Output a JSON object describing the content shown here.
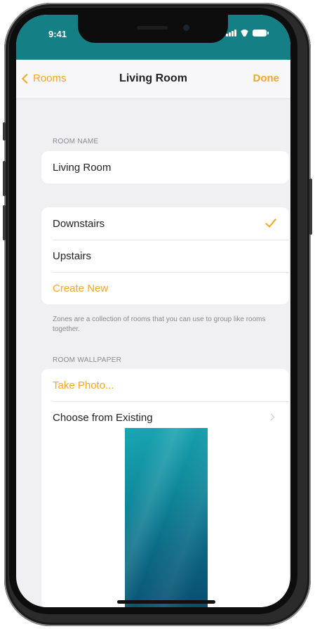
{
  "status_bar": {
    "time": "9:41",
    "signal_bars": 4,
    "battery_level": 1.0
  },
  "nav": {
    "back_label": "Rooms",
    "title": "Living Room",
    "done_label": "Done"
  },
  "room_name": {
    "header": "ROOM NAME",
    "value": "Living Room"
  },
  "zones": {
    "items": [
      {
        "label": "Downstairs",
        "selected": true
      },
      {
        "label": "Upstairs",
        "selected": false
      }
    ],
    "create_new_label": "Create New",
    "footer": "Zones are a collection of rooms that you can use to group like rooms together."
  },
  "wallpaper": {
    "header": "ROOM WALLPAPER",
    "take_photo_label": "Take Photo...",
    "choose_existing_label": "Choose from Existing"
  },
  "colors": {
    "accent": "#f5a623",
    "status_bar_bg": "#157f86",
    "background": "#f0f0f3",
    "wallpaper_top": "#1aa6b4",
    "wallpaper_bottom": "#094d6e"
  },
  "icons": {
    "back": "chevron-left-icon",
    "selected": "checkmark-icon",
    "disclosure": "chevron-right-icon"
  }
}
